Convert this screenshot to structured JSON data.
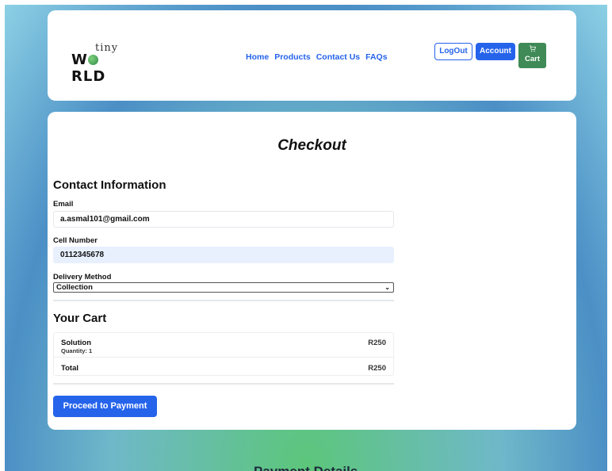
{
  "header": {
    "logo_top": "tiny",
    "logo_bottom_pre": "W",
    "logo_bottom_post": "RLD",
    "nav": [
      "Home",
      "Products",
      "Contact Us",
      "FAQs"
    ],
    "logout_label": "LogOut",
    "account_label": "Account",
    "cart_label": "Cart"
  },
  "checkout": {
    "title": "Checkout",
    "contact_section": "Contact Information",
    "email_label": "Email",
    "email_value": "a.asmal101@gmail.com",
    "cell_label": "Cell Number",
    "cell_value": "0112345678",
    "delivery_label": "Delivery Method",
    "delivery_selected": "Collection",
    "cart_section": "Your Cart",
    "cart_items": [
      {
        "name": "Solution",
        "quantity": "Quantity: 1",
        "price": "R250"
      }
    ],
    "total_label": "Total",
    "total_value": "R250",
    "pay_button": "Proceed to Payment"
  },
  "below": {
    "next_section_title": "Payment Details"
  },
  "colors": {
    "primary": "#2563eb",
    "cart_button": "#3f8a56",
    "autofill_bg": "#e8f0fe"
  }
}
